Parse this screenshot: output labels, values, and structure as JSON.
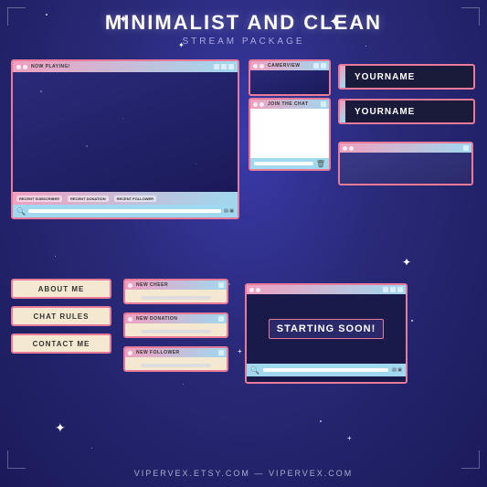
{
  "header": {
    "title": "MINIMALIST AND CLEAN",
    "subtitle": "STREAM PACKAGE"
  },
  "panels": {
    "about_me": "ABOUT ME",
    "chat_rules": "CHAT RULES",
    "contact_me": "CONTACT ME"
  },
  "alerts": {
    "cheer": "NEW CHEER",
    "donation": "NEW DONATION",
    "follower": "NEW FOLLOWER"
  },
  "nameplates": {
    "name1": "YOURNAME",
    "name2": "YOURNAME"
  },
  "windows": {
    "now_playing": "NOW PLAYING!",
    "cam_label": "CAMERVIEW",
    "join_chat": "JOIN THE CHAT",
    "recent_sub": "RECENT SUBSCRIBER",
    "recent_donation": "RECENT DONATION",
    "recent_follower": "RECENT FOLLOWER"
  },
  "starting_soon": "STARTING SOON!",
  "footer": {
    "left": "VIPERVEX.ETSY.COM",
    "dash": "—",
    "right": "VIPERVEX.COM"
  }
}
